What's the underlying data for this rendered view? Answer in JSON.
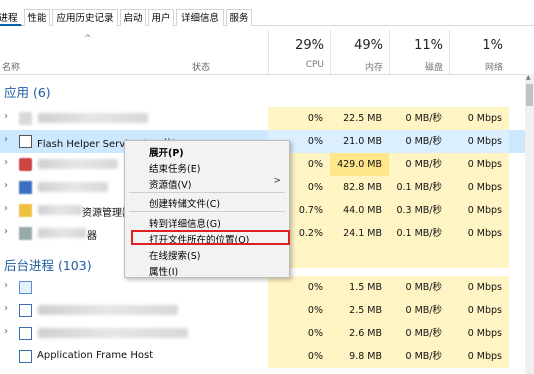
{
  "tabs": [
    "进程",
    "性能",
    "应用历史记录",
    "启动",
    "用户",
    "详细信息",
    "服务"
  ],
  "header": {
    "sort_arrow": "^",
    "name_label": "名称",
    "status_label": "状态",
    "columns": [
      {
        "pct": "29%",
        "label": "CPU"
      },
      {
        "pct": "49%",
        "label": "内存"
      },
      {
        "pct": "11%",
        "label": "磁盘"
      },
      {
        "pct": "1%",
        "label": "网络"
      }
    ]
  },
  "sections": {
    "apps": "应用 (6)",
    "background": "后台进程 (103)"
  },
  "app_rows": [
    {
      "name": "",
      "cpu": "0%",
      "mem": "22.5 MB",
      "disk": "0 MB/秒",
      "net": "0 Mbps"
    },
    {
      "name": "Flash Helper Service (32 位)",
      "cpu": "0%",
      "mem": "21.0 MB",
      "disk": "0 MB/秒",
      "net": "0 Mbps"
    },
    {
      "name": "",
      "cpu": "0%",
      "mem": "429.0 MB",
      "disk": "0 MB/秒",
      "net": "0 Mbps"
    },
    {
      "name": "",
      "cpu": "0%",
      "mem": "82.8 MB",
      "disk": "0.1 MB/秒",
      "net": "0 Mbps"
    },
    {
      "name": "资源管理器",
      "cpu": "0.7%",
      "mem": "44.0 MB",
      "disk": "0.3 MB/秒",
      "net": "0 Mbps"
    },
    {
      "name": "器",
      "cpu": "0.2%",
      "mem": "24.1 MB",
      "disk": "0.1 MB/秒",
      "net": "0 Mbps"
    }
  ],
  "bg_rows": [
    {
      "name": "",
      "cpu": "0%",
      "mem": "1.5 MB",
      "disk": "0 MB/秒",
      "net": "0 Mbps"
    },
    {
      "name": "",
      "cpu": "0%",
      "mem": "2.5 MB",
      "disk": "0 MB/秒",
      "net": "0 Mbps"
    },
    {
      "name": "",
      "cpu": "0%",
      "mem": "2.6 MB",
      "disk": "0 MB/秒",
      "net": "0 Mbps"
    },
    {
      "name": "Application Frame Host",
      "cpu": "0%",
      "mem": "9.8 MB",
      "disk": "0 MB/秒",
      "net": "0 Mbps"
    }
  ],
  "context_menu": {
    "expand": "展开(P)",
    "end_task": "结束任务(E)",
    "resource_values": "资源值(V)",
    "create_dump": "创建转储文件(C)",
    "goto_details": "转到详细信息(G)",
    "open_location": "打开文件所在的位置(O)",
    "search_online": "在线搜索(S)",
    "properties": "属性(I)",
    "submenu_arrow": ">"
  },
  "colors": {
    "accent": "#1f5ba8",
    "selected_row": "#cce8ff",
    "heat_light": "#fff4c4",
    "heat_medium": "#ffe68a",
    "highlight_box": "#e02020"
  }
}
